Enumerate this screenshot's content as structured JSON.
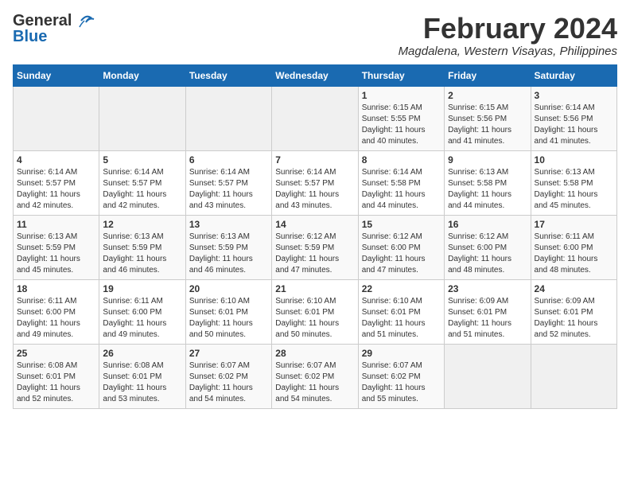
{
  "header": {
    "logo_line1": "General",
    "logo_line2": "Blue",
    "month_title": "February 2024",
    "location": "Magdalena, Western Visayas, Philippines"
  },
  "days_of_week": [
    "Sunday",
    "Monday",
    "Tuesday",
    "Wednesday",
    "Thursday",
    "Friday",
    "Saturday"
  ],
  "weeks": [
    [
      {
        "day": "",
        "info": ""
      },
      {
        "day": "",
        "info": ""
      },
      {
        "day": "",
        "info": ""
      },
      {
        "day": "",
        "info": ""
      },
      {
        "day": "1",
        "info": "Sunrise: 6:15 AM\nSunset: 5:55 PM\nDaylight: 11 hours\nand 40 minutes."
      },
      {
        "day": "2",
        "info": "Sunrise: 6:15 AM\nSunset: 5:56 PM\nDaylight: 11 hours\nand 41 minutes."
      },
      {
        "day": "3",
        "info": "Sunrise: 6:14 AM\nSunset: 5:56 PM\nDaylight: 11 hours\nand 41 minutes."
      }
    ],
    [
      {
        "day": "4",
        "info": "Sunrise: 6:14 AM\nSunset: 5:57 PM\nDaylight: 11 hours\nand 42 minutes."
      },
      {
        "day": "5",
        "info": "Sunrise: 6:14 AM\nSunset: 5:57 PM\nDaylight: 11 hours\nand 42 minutes."
      },
      {
        "day": "6",
        "info": "Sunrise: 6:14 AM\nSunset: 5:57 PM\nDaylight: 11 hours\nand 43 minutes."
      },
      {
        "day": "7",
        "info": "Sunrise: 6:14 AM\nSunset: 5:57 PM\nDaylight: 11 hours\nand 43 minutes."
      },
      {
        "day": "8",
        "info": "Sunrise: 6:14 AM\nSunset: 5:58 PM\nDaylight: 11 hours\nand 44 minutes."
      },
      {
        "day": "9",
        "info": "Sunrise: 6:13 AM\nSunset: 5:58 PM\nDaylight: 11 hours\nand 44 minutes."
      },
      {
        "day": "10",
        "info": "Sunrise: 6:13 AM\nSunset: 5:58 PM\nDaylight: 11 hours\nand 45 minutes."
      }
    ],
    [
      {
        "day": "11",
        "info": "Sunrise: 6:13 AM\nSunset: 5:59 PM\nDaylight: 11 hours\nand 45 minutes."
      },
      {
        "day": "12",
        "info": "Sunrise: 6:13 AM\nSunset: 5:59 PM\nDaylight: 11 hours\nand 46 minutes."
      },
      {
        "day": "13",
        "info": "Sunrise: 6:13 AM\nSunset: 5:59 PM\nDaylight: 11 hours\nand 46 minutes."
      },
      {
        "day": "14",
        "info": "Sunrise: 6:12 AM\nSunset: 5:59 PM\nDaylight: 11 hours\nand 47 minutes."
      },
      {
        "day": "15",
        "info": "Sunrise: 6:12 AM\nSunset: 6:00 PM\nDaylight: 11 hours\nand 47 minutes."
      },
      {
        "day": "16",
        "info": "Sunrise: 6:12 AM\nSunset: 6:00 PM\nDaylight: 11 hours\nand 48 minutes."
      },
      {
        "day": "17",
        "info": "Sunrise: 6:11 AM\nSunset: 6:00 PM\nDaylight: 11 hours\nand 48 minutes."
      }
    ],
    [
      {
        "day": "18",
        "info": "Sunrise: 6:11 AM\nSunset: 6:00 PM\nDaylight: 11 hours\nand 49 minutes."
      },
      {
        "day": "19",
        "info": "Sunrise: 6:11 AM\nSunset: 6:00 PM\nDaylight: 11 hours\nand 49 minutes."
      },
      {
        "day": "20",
        "info": "Sunrise: 6:10 AM\nSunset: 6:01 PM\nDaylight: 11 hours\nand 50 minutes."
      },
      {
        "day": "21",
        "info": "Sunrise: 6:10 AM\nSunset: 6:01 PM\nDaylight: 11 hours\nand 50 minutes."
      },
      {
        "day": "22",
        "info": "Sunrise: 6:10 AM\nSunset: 6:01 PM\nDaylight: 11 hours\nand 51 minutes."
      },
      {
        "day": "23",
        "info": "Sunrise: 6:09 AM\nSunset: 6:01 PM\nDaylight: 11 hours\nand 51 minutes."
      },
      {
        "day": "24",
        "info": "Sunrise: 6:09 AM\nSunset: 6:01 PM\nDaylight: 11 hours\nand 52 minutes."
      }
    ],
    [
      {
        "day": "25",
        "info": "Sunrise: 6:08 AM\nSunset: 6:01 PM\nDaylight: 11 hours\nand 52 minutes."
      },
      {
        "day": "26",
        "info": "Sunrise: 6:08 AM\nSunset: 6:01 PM\nDaylight: 11 hours\nand 53 minutes."
      },
      {
        "day": "27",
        "info": "Sunrise: 6:07 AM\nSunset: 6:02 PM\nDaylight: 11 hours\nand 54 minutes."
      },
      {
        "day": "28",
        "info": "Sunrise: 6:07 AM\nSunset: 6:02 PM\nDaylight: 11 hours\nand 54 minutes."
      },
      {
        "day": "29",
        "info": "Sunrise: 6:07 AM\nSunset: 6:02 PM\nDaylight: 11 hours\nand 55 minutes."
      },
      {
        "day": "",
        "info": ""
      },
      {
        "day": "",
        "info": ""
      }
    ]
  ]
}
